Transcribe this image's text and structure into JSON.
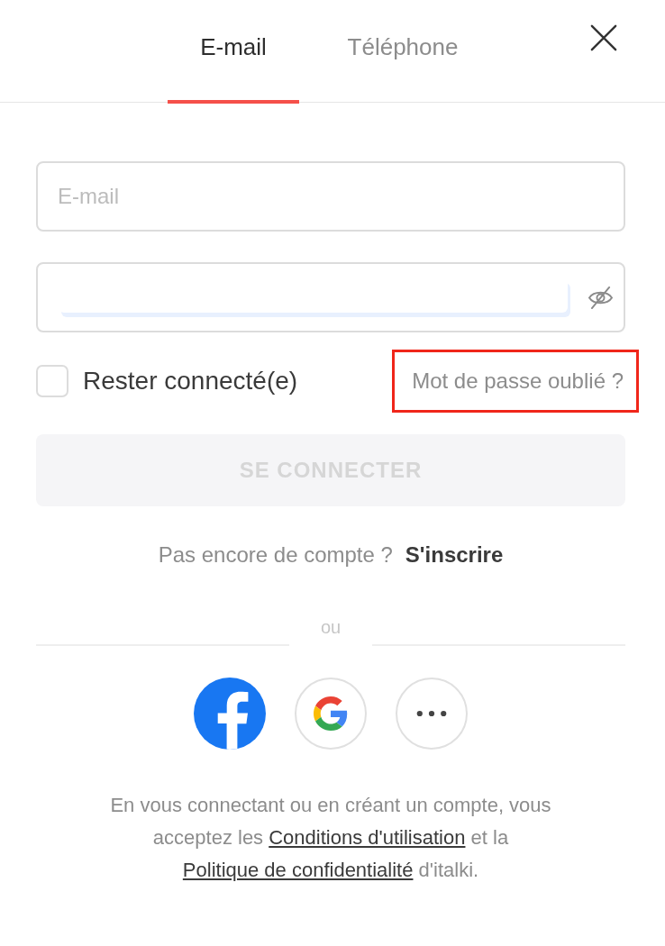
{
  "tabs": [
    {
      "label": "E-mail",
      "selected": true
    },
    {
      "label": "Téléphone",
      "selected": false
    }
  ],
  "email_field": {
    "placeholder": "E-mail"
  },
  "password_field": {
    "password_visible": false
  },
  "remember_me": {
    "label": "Rester connecté(e)",
    "checked": false
  },
  "forgot_password": {
    "label": "Mot de passe oublié ?",
    "highlighted": true
  },
  "login_button": {
    "label": "SE CONNECTER",
    "disabled": true
  },
  "signup": {
    "prompt": "Pas encore de compte ?",
    "link": "S'inscrire"
  },
  "divider": {
    "label": "ou"
  },
  "social_logins": [
    {
      "kind": "facebook"
    },
    {
      "kind": "google"
    },
    {
      "kind": "more"
    }
  ],
  "legal": [
    {
      "kind": "text",
      "text": "En vous connectant ou en créant un compte, vous acceptez les "
    },
    {
      "kind": "link",
      "text": "Conditions d'utilisation"
    },
    {
      "kind": "text",
      "text": " et la "
    },
    {
      "kind": "link",
      "text": "Politique de confidentialité"
    },
    {
      "kind": "text",
      "text": " d'italki."
    }
  ]
}
